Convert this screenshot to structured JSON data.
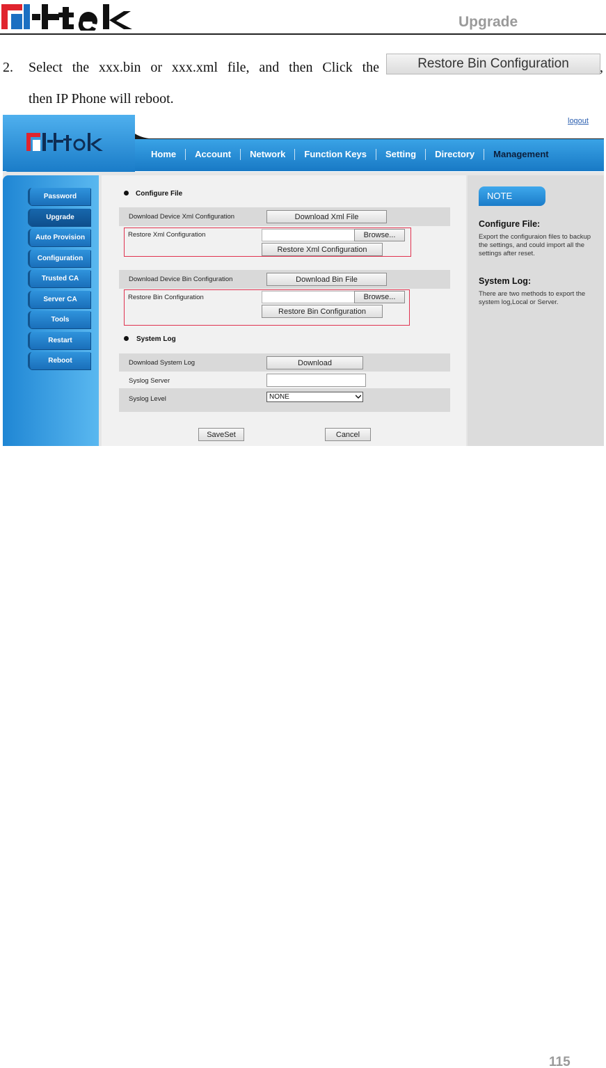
{
  "header": {
    "section_title": "Upgrade",
    "logo_text": "Htek",
    "brand_red": "#e0242e",
    "brand_blue": "#1b6fc2"
  },
  "step": {
    "number": "2.",
    "line1": "Select the xxx.bin or xxx.xml file, and then Click the",
    "inline_button": "Restore Bin Configuration",
    "comma": ",",
    "line2": "then IP Phone will reboot."
  },
  "screenshot": {
    "logout": "logout",
    "nav": [
      "Home",
      "Account",
      "Network",
      "Function Keys",
      "Setting",
      "Directory",
      "Management"
    ],
    "active_nav": "Management",
    "sidebar": [
      "Password",
      "Upgrade",
      "Auto Provision",
      "Configuration",
      "Trusted CA",
      "Server CA",
      "Tools",
      "Restart",
      "Reboot"
    ],
    "configure_file": {
      "title": "Configure File",
      "download_xml_label": "Download Device Xml Configuration",
      "download_xml_button": "Download Xml File",
      "restore_xml_label": "Restore Xml Configuration",
      "browse1": "Browse...",
      "restore_xml_button": "Restore Xml Configuration",
      "download_bin_label": "Download Device Bin Configuration",
      "download_bin_button": "Download Bin File",
      "restore_bin_label": "Restore Bin Configuration",
      "browse2": "Browse...",
      "restore_bin_button": "Restore Bin Configuration"
    },
    "system_log": {
      "title": "System Log",
      "download_label": "Download System Log",
      "download_button": "Download",
      "server_label": "Syslog Server",
      "server_value": "",
      "level_label": "Syslog Level",
      "level_value": "NONE"
    },
    "actions": {
      "save": "SaveSet",
      "cancel": "Cancel"
    },
    "note": {
      "tab": "NOTE",
      "cf_head": "Configure File:",
      "cf_text": "Export the configuraion files to backup the settings, and could import all the settings after reset.",
      "sl_head": "System Log:",
      "sl_text": "There are two methods to export the system log,Local or Server."
    },
    "highlight_color": "#e0324f"
  },
  "page_number": "115"
}
